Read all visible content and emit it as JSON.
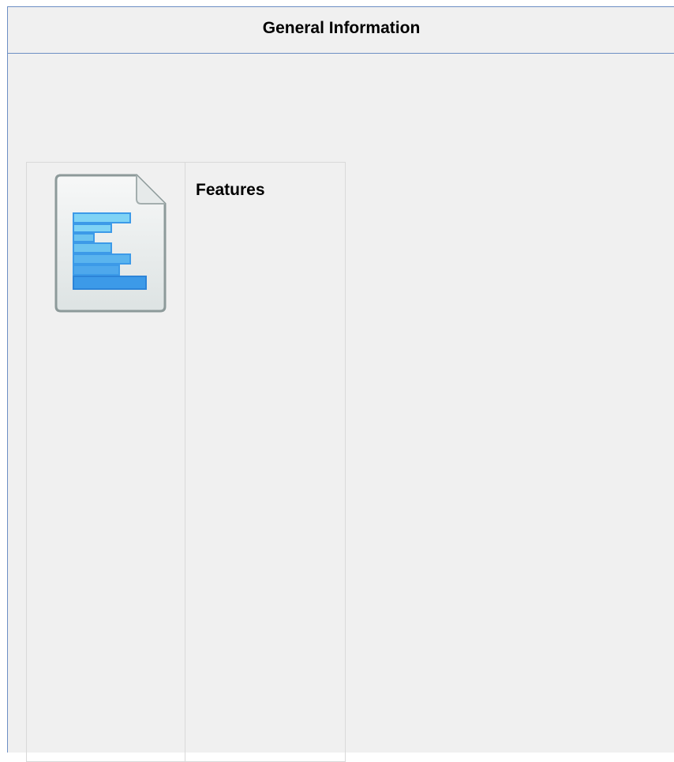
{
  "panel": {
    "title": "General Information"
  },
  "grid": {
    "label": "Features",
    "icon": "document-list-icon"
  },
  "colors": {
    "border_blue": "#6d8fc4",
    "background": "#f0f0f0",
    "cell_border": "#d9d9d9",
    "icon_blue": "#3c9ae8",
    "icon_light_blue": "#7fd3f5"
  }
}
